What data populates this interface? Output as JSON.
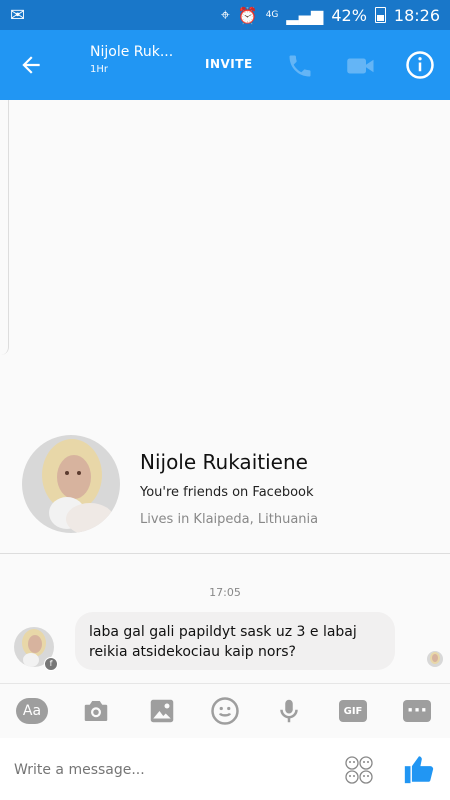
{
  "status_bar": {
    "network": "4G",
    "battery": "42%",
    "time": "18:26"
  },
  "header": {
    "title": "Nijole Ruk...",
    "subtitle": "1Hr",
    "invite": "INVITE"
  },
  "profile": {
    "name": "Nijole Rukaitiene",
    "friends_text": "You're friends on Facebook",
    "lives_text": "Lives in Klaipeda, Lithuania"
  },
  "conversation": {
    "timestamp": "17:05",
    "message": "laba gal gali papildyt sask uz 3 e labaj reikia atsidekociau kaip nors?"
  },
  "composer": {
    "aa_label": "Aa",
    "gif_label": "GIF",
    "placeholder": "Write a message..."
  },
  "colors": {
    "brand_blue": "#2196f3",
    "status_blue": "#1977c9",
    "icon_gray": "#9e9e9e",
    "bubble_gray": "#f1f0f0"
  }
}
